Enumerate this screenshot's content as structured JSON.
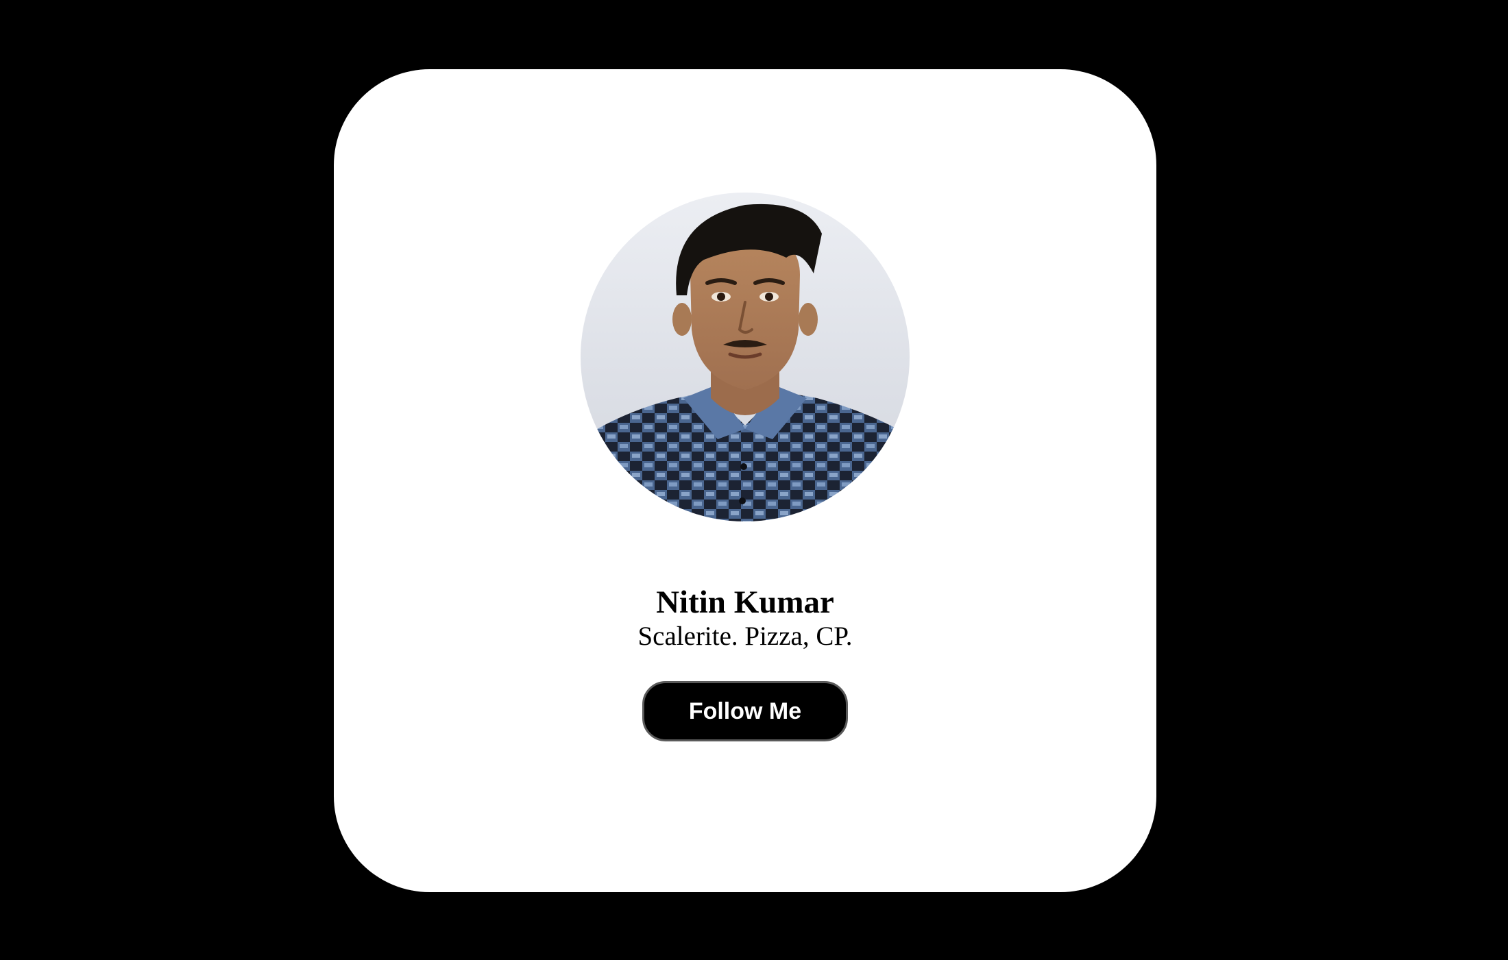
{
  "profile": {
    "name": "Nitin Kumar",
    "tagline": "Scalerite. Pizza, CP.",
    "avatar_alt": "profile photo"
  },
  "actions": {
    "follow_label": "Follow Me"
  },
  "colors": {
    "page_background": "#000000",
    "card_background": "#ffffff",
    "button_background": "#000000",
    "button_text": "#ffffff"
  }
}
